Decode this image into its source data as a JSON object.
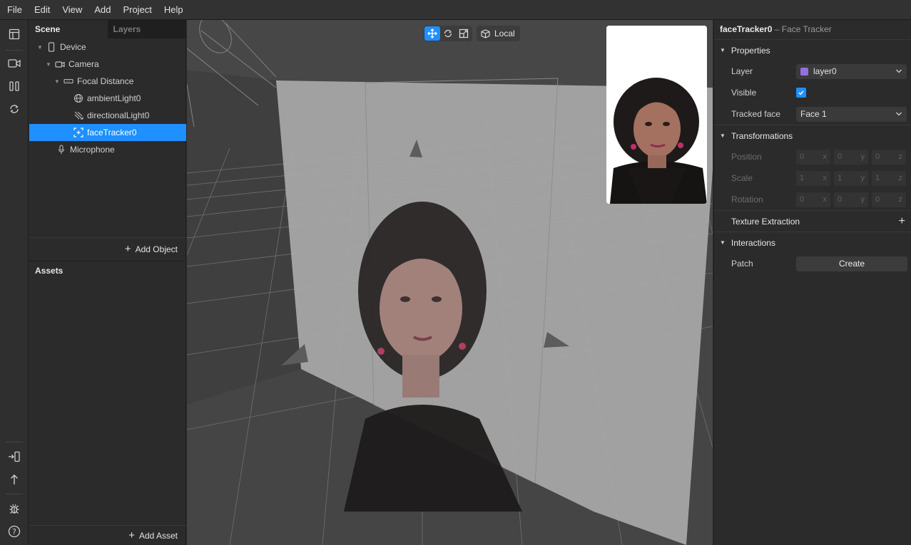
{
  "menubar": {
    "items": [
      "File",
      "Edit",
      "View",
      "Add",
      "Project",
      "Help"
    ]
  },
  "scene_panel": {
    "tabs": [
      "Scene",
      "Layers"
    ],
    "tree": [
      {
        "label": "Device",
        "icon": "phone-icon"
      },
      {
        "label": "Camera",
        "icon": "camera-icon"
      },
      {
        "label": "Focal Distance",
        "icon": "focal-distance-icon"
      },
      {
        "label": "ambientLight0",
        "icon": "ambient-light-icon"
      },
      {
        "label": "directionalLight0",
        "icon": "directional-light-icon"
      },
      {
        "label": "faceTracker0",
        "icon": "face-tracker-icon"
      },
      {
        "label": "Microphone",
        "icon": "microphone-icon"
      }
    ],
    "add_object": "Add Object"
  },
  "assets_panel": {
    "title": "Assets",
    "add_asset": "Add Asset"
  },
  "viewport": {
    "local_label": "Local"
  },
  "inspector": {
    "title_name": "faceTracker0",
    "title_type": "– Face Tracker",
    "properties": "Properties",
    "layer_label": "Layer",
    "layer_value": "layer0",
    "layer_color": "#9370db",
    "visible_label": "Visible",
    "visible_checked": true,
    "tracked_face_label": "Tracked face",
    "tracked_face_value": "Face 1",
    "transformations": "Transformations",
    "position_label": "Position",
    "position": [
      "0",
      "0",
      "0"
    ],
    "scale_label": "Scale",
    "scale": [
      "1",
      "1",
      "1"
    ],
    "rotation_label": "Rotation",
    "rotation": [
      "0",
      "0",
      "0"
    ],
    "axes": [
      "x",
      "y",
      "z"
    ],
    "texture_extraction": "Texture Extraction",
    "interactions": "Interactions",
    "patch_label": "Patch",
    "create_label": "Create"
  },
  "colors": {
    "accent": "#1e90ff",
    "panel": "#2b2b2b",
    "viewport": "#474747"
  }
}
